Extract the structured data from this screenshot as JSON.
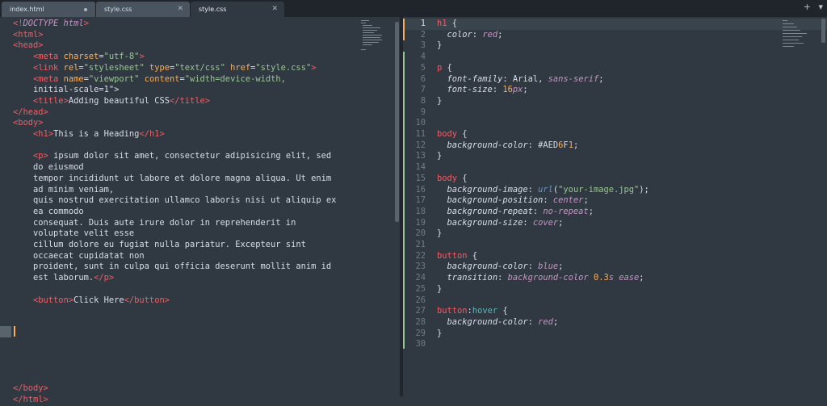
{
  "tabs": [
    {
      "label": "index.html",
      "state": "modified",
      "active": false
    },
    {
      "label": "style.css",
      "state": "clean",
      "active": false
    },
    {
      "label": "style.css",
      "state": "clean",
      "active": true
    }
  ],
  "tab_tools": {
    "add": "+",
    "menu": "▾"
  },
  "left_pane": {
    "file": "index.html",
    "lines": [
      "<!DOCTYPE html>",
      "<html>",
      "<head>",
      "    <meta charset=\"utf-8\">",
      "    <link rel=\"stylesheet\" type=\"text/css\" href=\"style.css\">",
      "    <meta name=\"viewport\" content=\"width=device-width,",
      "    initial-scale=1\">",
      "    <title>Adding beautiful CSS</title>",
      "</head>",
      "<body>",
      "    <h1>This is a Heading</h1>",
      "",
      "    <p> ipsum dolor sit amet, consectetur adipisicing elit, sed",
      "    do eiusmod",
      "    tempor incididunt ut labore et dolore magna aliqua. Ut enim",
      "    ad minim veniam,",
      "    quis nostrud exercitation ullamco laboris nisi ut aliquip ex",
      "    ea commodo",
      "    consequat. Duis aute irure dolor in reprehenderit in",
      "    voluptate velit esse",
      "    cillum dolore eu fugiat nulla pariatur. Excepteur sint",
      "    occaecat cupidatat non",
      "    proident, sunt in culpa qui officia deserunt mollit anim id",
      "    est laborum.</p>",
      "",
      "    <button>Click Here</button>",
      "",
      "",
      "",
      "",
      "",
      "",
      "",
      "</body>",
      "</html>"
    ]
  },
  "right_pane": {
    "file": "style.css",
    "current_line": 1,
    "line_numbers": [
      "1",
      "2",
      "3",
      "4",
      "5",
      "6",
      "7",
      "8",
      "9",
      "10",
      "11",
      "12",
      "13",
      "14",
      "15",
      "16",
      "17",
      "18",
      "19",
      "20",
      "21",
      "22",
      "23",
      "24",
      "25",
      "26",
      "27",
      "28",
      "29",
      "30"
    ],
    "lines": [
      "h1 {",
      "  color: red;",
      "}",
      "",
      "p {",
      "  font-family: Arial, sans-serif;",
      "  font-size: 16px;",
      "}",
      "",
      "",
      "body {",
      "  background-color: #AED6F1;",
      "}",
      "",
      "body {",
      "  background-image: url(\"your-image.jpg\");",
      "  background-position: center;",
      "  background-repeat: no-repeat;",
      "  background-size: cover;",
      "}",
      "",
      "button {",
      "  background-color: blue;",
      "  transition: background-color 0.3s ease;",
      "}",
      "",
      "button:hover {",
      "  background-color: red;",
      "}",
      ""
    ]
  },
  "colors": {
    "editor_bg": "#303841",
    "tabbar_bg": "#1f252b",
    "tag": "#ec5f66",
    "attr": "#f9ae58",
    "string": "#99c794",
    "keyword": "#c695c6",
    "property": "#5fb4b4",
    "diff_modified": "#f9ae58",
    "diff_added": "#99c794"
  }
}
